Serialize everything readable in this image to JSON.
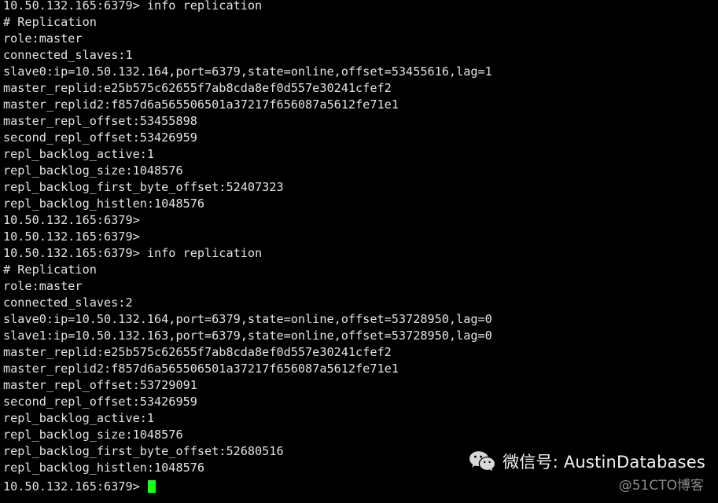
{
  "terminal": {
    "prompt": "10.50.132.165:6379>",
    "cursor": "block-cursor",
    "foreground_color": "#e3e3e3",
    "background_color": "#000000",
    "cursor_color": "#17ff17",
    "lines": [
      "10.50.132.165:6379> info replication",
      "# Replication",
      "role:master",
      "connected_slaves:1",
      "slave0:ip=10.50.132.164,port=6379,state=online,offset=53455616,lag=1",
      "master_replid:e25b575c62655f7ab8cda8ef0d557e30241cfef2",
      "master_replid2:f857d6a565506501a37217f656087a5612fe71e1",
      "master_repl_offset:53455898",
      "second_repl_offset:53426959",
      "repl_backlog_active:1",
      "repl_backlog_size:1048576",
      "repl_backlog_first_byte_offset:52407323",
      "repl_backlog_histlen:1048576",
      "10.50.132.165:6379>",
      "10.50.132.165:6379>",
      "10.50.132.165:6379> info replication",
      "# Replication",
      "role:master",
      "connected_slaves:2",
      "slave0:ip=10.50.132.164,port=6379,state=online,offset=53728950,lag=0",
      "slave1:ip=10.50.132.163,port=6379,state=online,offset=53728950,lag=0",
      "master_replid:e25b575c62655f7ab8cda8ef0d557e30241cfef2",
      "master_replid2:f857d6a565506501a37217f656087a5612fe71e1",
      "master_repl_offset:53729091",
      "second_repl_offset:53426959",
      "repl_backlog_active:1",
      "repl_backlog_size:1048576",
      "repl_backlog_first_byte_offset:52680516",
      "repl_backlog_histlen:1048576"
    ],
    "last_line": "10.50.132.165:6379>"
  },
  "watermark": {
    "icon": "wechat-icon",
    "text": "微信号: AustinDatabases",
    "subtext": "@51CTO博客"
  }
}
